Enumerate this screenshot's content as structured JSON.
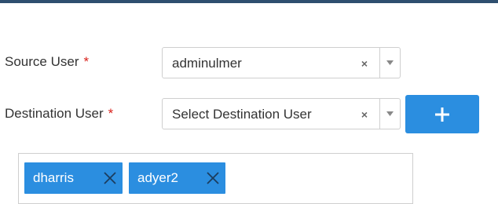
{
  "form": {
    "source_user": {
      "label": "Source User",
      "required_mark": "*",
      "value": "adminulmer"
    },
    "destination_user": {
      "label": "Destination User",
      "required_mark": "*",
      "placeholder": "Select Destination User"
    },
    "add_button": {
      "icon": "plus-icon",
      "label": "+"
    },
    "selected_users": [
      {
        "label": "dharris"
      },
      {
        "label": "adyer2"
      }
    ]
  },
  "icons": {
    "clear": "×",
    "dropdown": "caret-down-icon",
    "tag_remove": "close-icon"
  },
  "colors": {
    "accent": "#2b8ee0",
    "required": "#d9221c",
    "top_rule": "#2f4f6f"
  }
}
